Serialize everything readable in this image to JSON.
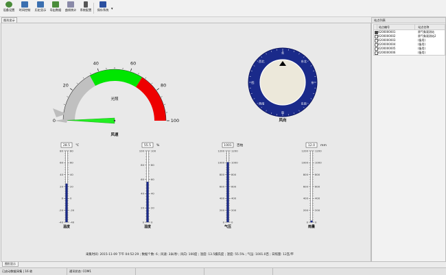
{
  "toolbar": {
    "buttons": [
      {
        "label": "设备设置",
        "color": "#4a8c3a"
      },
      {
        "label": "时间控制",
        "color": "#3a6fb0"
      },
      {
        "label": "历史显示",
        "color": "#3a6fb0"
      },
      {
        "label": "导出数据",
        "color": "#4a8c3a"
      },
      {
        "label": "曲线统计",
        "color": "#7a7a9a"
      },
      {
        "label": "系统配置",
        "color": "#555555"
      },
      {
        "label": "保存系统",
        "color": "#2a4fa0"
      }
    ]
  },
  "main_tab": "图形显示",
  "gauge": {
    "title": "风速",
    "center_label": "光照",
    "ticks": [
      "0",
      "20",
      "40",
      "60",
      "80",
      "100"
    ],
    "value": 3,
    "colors": {
      "low": "#c0c0c0",
      "mid": "#00e600",
      "high": "#ee0000"
    }
  },
  "compass": {
    "title": "风向",
    "bezel_color": "#1a2a8a",
    "face_color": "#ece8da",
    "directions": [
      "北",
      "东北",
      "东",
      "东南",
      "南",
      "西南",
      "西",
      "西北"
    ]
  },
  "thermometers": [
    {
      "title": "温度",
      "value": "28.5",
      "unit": "℃",
      "ticks": [
        "-40",
        "-20",
        "0",
        "20",
        "40",
        "60",
        "80"
      ],
      "left_ticks": [
        "-40",
        "-20",
        "0",
        "20",
        "40",
        "60",
        "80"
      ],
      "level": 0.53
    },
    {
      "title": "湿度",
      "value": "55.5",
      "unit": "%",
      "ticks": [
        "0",
        "20",
        "40",
        "60",
        "80",
        "100"
      ],
      "left_ticks": [
        "0",
        "20",
        "40",
        "60",
        "80",
        "100"
      ],
      "level": 0.555
    },
    {
      "title": "气压",
      "value": "1001",
      "unit": "百帕",
      "ticks": [
        "0",
        "200",
        "400",
        "600",
        "800",
        "1000",
        "1200"
      ],
      "left_ticks": [
        "0",
        "200",
        "400",
        "600",
        "800",
        "1000",
        "1200"
      ],
      "level": 0.83
    },
    {
      "title": "雨量",
      "value": "12.0",
      "unit": "mm",
      "ticks": [
        "0",
        "200",
        "400",
        "600",
        "800",
        "1000",
        "1200"
      ],
      "left_ticks": [
        "0",
        "200",
        "400",
        "600",
        "800",
        "1000",
        "1200"
      ],
      "level": 0.01
    }
  ],
  "status_line": "采集时间: 2015-11-09 下午 04:52:29 ; 数据个数: 6 ; 风速: 3米/秒 ; 风向: 100度 ; 温度: 13.5摄氏度 ; 湿度: 55.5% ; 气压: 1001.0百 ; 日照量: 12瓦/平",
  "right_panel": {
    "title": "站点列表",
    "headers": [
      "站点编号",
      "站点名称"
    ],
    "rows": [
      {
        "checked": true,
        "id": "4200000001",
        "name": "原气象观测站"
      },
      {
        "checked": false,
        "id": "4200000002",
        "name": "原气象观测站2"
      },
      {
        "checked": false,
        "id": "4200000003",
        "name": "(备用)"
      },
      {
        "checked": false,
        "id": "4200000004",
        "name": "(备用)"
      },
      {
        "checked": false,
        "id": "4200000005",
        "name": "(备用)"
      },
      {
        "checked": false,
        "id": "4200000006",
        "name": "(备用)"
      }
    ]
  },
  "bottom_tab": "图形显示",
  "statusbar": {
    "seg1": "已启动数据采集 | 16 收",
    "seg2": "通讯状态: COM1"
  }
}
